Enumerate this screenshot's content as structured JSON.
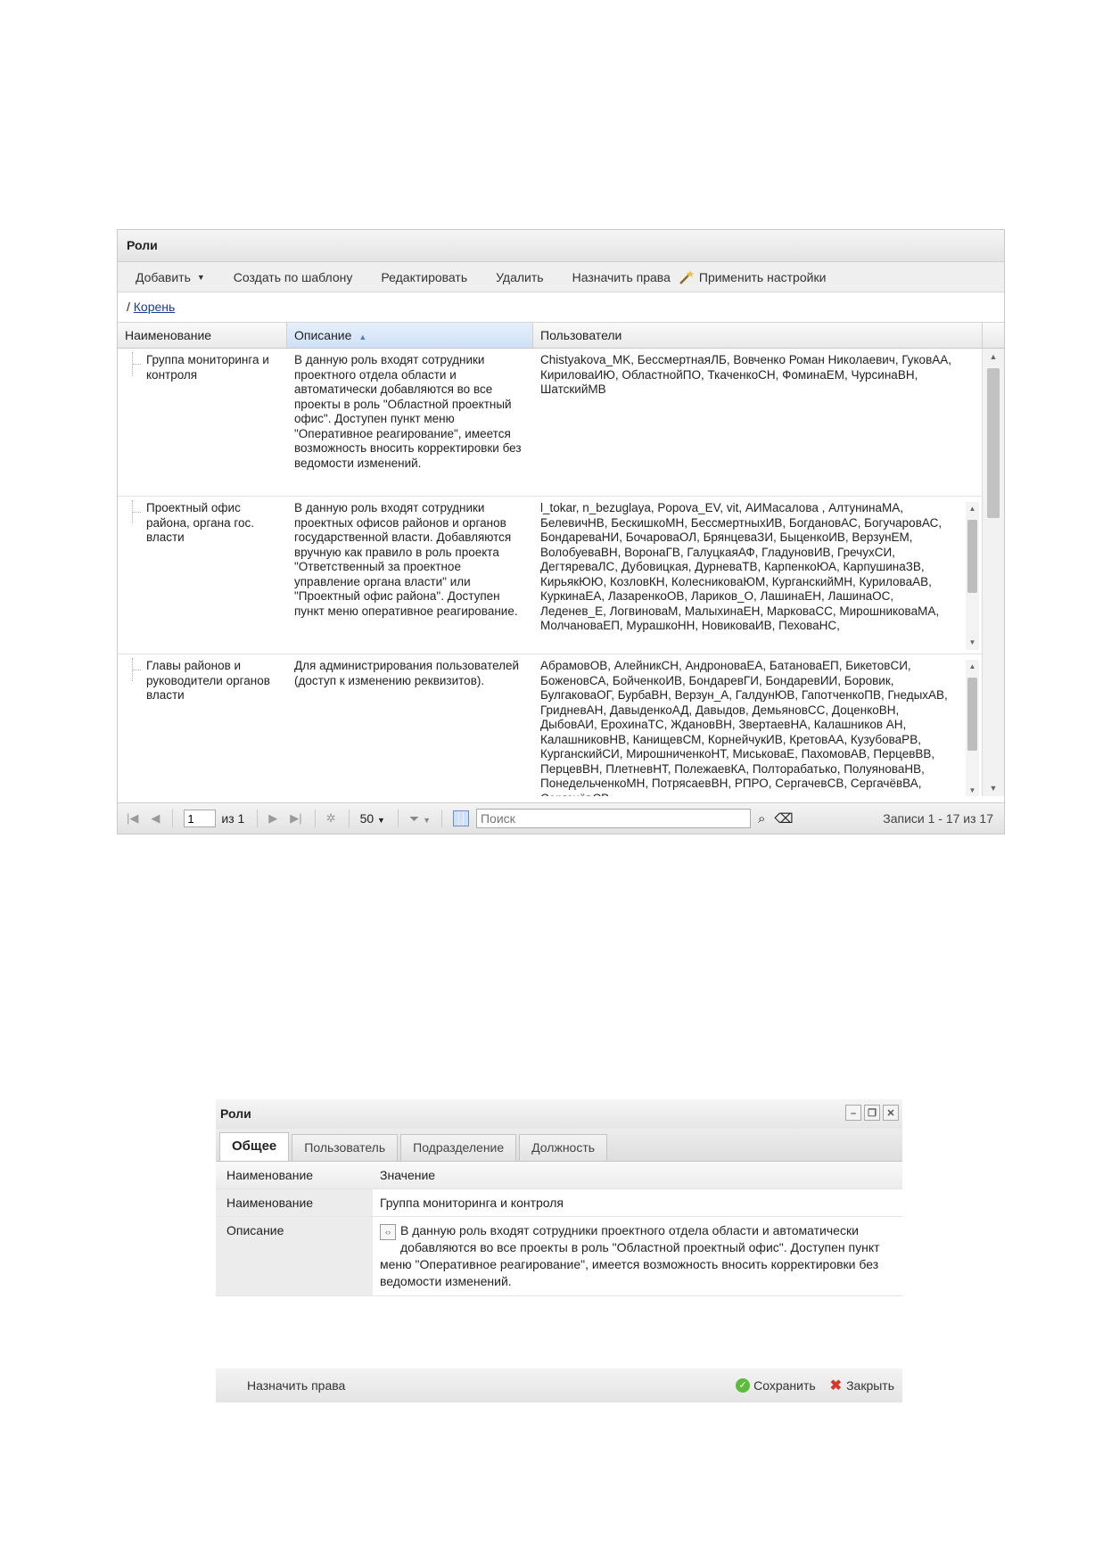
{
  "grid_panel": {
    "title": "Роли",
    "toolbar": {
      "add": "Добавить",
      "create_from_template": "Создать по шаблону",
      "edit": "Редактировать",
      "delete": "Удалить",
      "assign_rights": "Назначить права",
      "apply_settings": "Применить настройки"
    },
    "breadcrumb": {
      "separator": "/",
      "root": "Корень"
    },
    "columns": [
      "Наименование",
      "Описание",
      "Пользователи"
    ],
    "rows": [
      {
        "name": "Группа мониторинга и контроля",
        "description": "В данную роль входят сотрудники проектного отдела области и автоматически добавляются во все проекты в роль \"Областной проектный офис\". Доступен пункт меню \"Оперативное реагирование\", имеется возможность вносить корректировки без ведомости изменений.",
        "users": "Chistyakova_MK, БессмертнаяЛБ, Вовченко Роман Николаевич, ГуковАА, КириловаИЮ, ОбластнойПО, ТкаченкоСН, ФоминаЕМ, ЧурсинаВН, ШатскийМВ"
      },
      {
        "name": "Проектный офис района, органа гос. власти",
        "description": "В данную роль входят сотрудники проектных офисов районов и органов государственной власти. Добавляются вручную как правило в роль проекта \"Ответственный за проектное управление органа власти\" или \"Проектный офис района\". Доступен пункт меню оперативное реагирование.",
        "users": "l_tokar, n_bezuglaya, Popova_EV, vit, АИМасалова , АлтунинаМА, БелевичНВ, БескишкоМН, БессмертныхИВ, БогдановАС, БогучаровАС, БондареваНИ, БочароваОЛ, БрянцеваЗИ, БыценкоИВ, ВерзунЕМ, ВолобуеваВН, ВоронаГВ, ГалуцкаяАФ, ГладуновИВ, ГречухСИ, ДегтяреваЛС, Дубовицкая, ДурневаТВ, КарпенкоЮА, КарпушинаЗВ, КирьякЮЮ, КозловКН, КолесниковаЮМ, КурганскийМН, КуриловаАВ, КуркинаЕА, ЛазаренкоОВ, Лариков_О, ЛашинаЕН, ЛашинаОС, Леденев_Е, ЛогвиноваМ, МалыхинаЕН, МарковаСС, МирошниковаМА, МолчановаЕП, МурашкоНН, НовиковаИВ, ПеховаНС,"
      },
      {
        "name": "Главы районов и руководители органов власти",
        "description": "Для администрирования пользователей (доступ к изменению реквизитов).",
        "users": "АбрамовОВ, АлейникСН, АндроноваЕА, БатановаЕП, БикетовСИ, БоженовСА, БойченкоИВ, БондаревГИ, БондаревИИ, Боровик, БулгаковаОГ, БурбаВН, Верзун_А, ГалдунЮВ, ГапотченкоПВ, ГнедыхАВ, ГридневАН, ДавыденкоАД, Давыдов, ДемьяновСС, ДоценкоВН, ДыбовАИ, ЕрохинаТС, ЖдановВН, ЗвертаевНА, Калашников АН, КалашниковНВ, КанищевСМ, КорнейчукИВ, КретовАА, КузубоваРВ, КурганскийСИ, МирошниченкоНТ, МиськоваЕ, ПахомовАВ, ПерцевВВ, ПерцевВН, ПлетневНТ, ПолежаевКА, Полторабатько, ПолуяноваНВ, ПонедельченкоМН, ПотрясаевВН, РПРО, СергачевСВ, СергачёвВА, СергачёвСВ,"
      }
    ],
    "pager": {
      "page": "1",
      "of_label": "из 1",
      "page_size": "50",
      "search_placeholder": "Поиск",
      "records": "Записи 1 - 17 из 17"
    }
  },
  "edit_window": {
    "title": "Роли",
    "tabs": [
      "Общее",
      "Пользователь",
      "Подразделение",
      "Должность"
    ],
    "active_tab": "Общее",
    "header": {
      "key": "Наименование",
      "value": "Значение"
    },
    "properties": [
      {
        "key": "Наименование",
        "value": "Группа мониторинга и контроля"
      },
      {
        "key": "Описание",
        "value": "В данную роль входят сотрудники проектного отдела области и автоматически добавляются во все проекты в роль \"Областной проектный офис\". Доступен пункт меню \"Оперативное реагирование\", имеется возможность вносить корректировки без ведомости изменений."
      }
    ],
    "footer": {
      "assign_rights": "Назначить права",
      "save": "Сохранить",
      "close": "Закрыть"
    }
  },
  "colors": {
    "sorted_header": "#cfe0f5",
    "link": "#1a3c8c",
    "save_icon": "#5dbb3a",
    "close_icon": "#d43a2b"
  },
  "icons": [
    "caret-down-icon",
    "magic-wand-icon",
    "sort-asc-icon",
    "pager-first-icon",
    "pager-prev-icon",
    "pager-next-icon",
    "pager-last-icon",
    "refresh-icon",
    "filter-icon",
    "columns-icon",
    "binoculars-icon",
    "eraser-icon",
    "minimize-icon",
    "restore-icon",
    "close-icon",
    "edit-icon",
    "check-circle-icon",
    "red-x-icon"
  ]
}
